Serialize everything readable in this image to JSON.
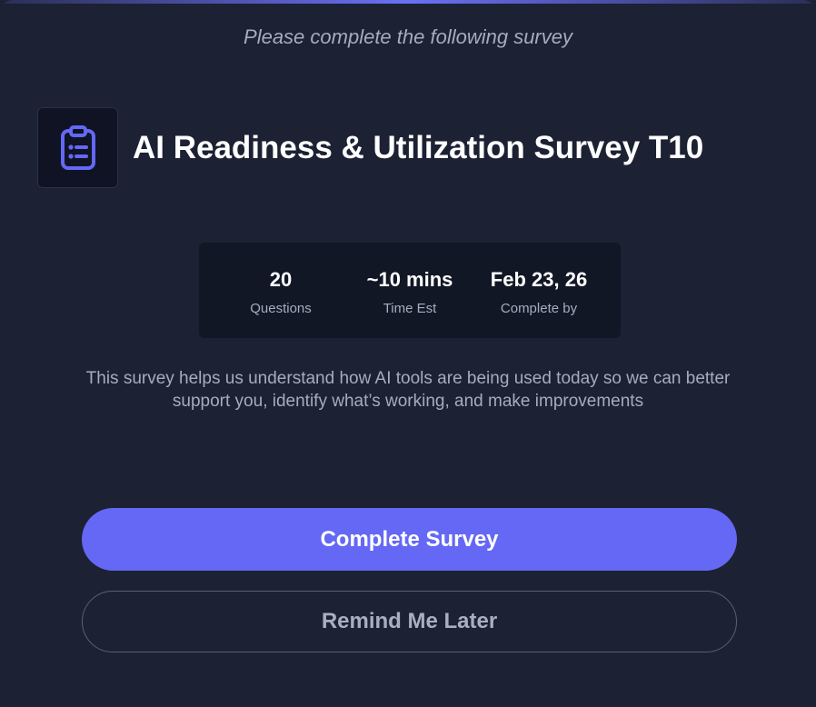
{
  "header": {
    "subtitle": "Please complete the following survey"
  },
  "survey": {
    "icon": "clipboard-list-icon",
    "title": "AI Readiness & Utilization Survey T10",
    "stats": [
      {
        "value": "20",
        "label": "Questions"
      },
      {
        "value": "~10 mins",
        "label": "Time Est"
      },
      {
        "value": "Feb 23, 26",
        "label": "Complete by"
      }
    ],
    "description": "This survey helps us understand how AI tools are being used today so we can better support you, identify what’s working, and make improvements"
  },
  "actions": {
    "primary_label": "Complete Survey",
    "secondary_label": "Remind Me Later"
  },
  "colors": {
    "background": "#1c2133",
    "accent": "#6468f5",
    "icon_box": "#0f1324",
    "stats_panel": "#121726",
    "muted_text": "#a6acbd"
  }
}
